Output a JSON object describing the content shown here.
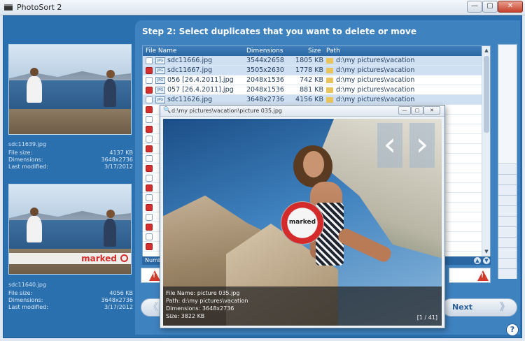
{
  "window": {
    "title": "PhotoSort 2",
    "min": "—",
    "max": "▢",
    "close": "✕"
  },
  "left_panel": {
    "photo1": {
      "filename": "sdc11639.jpg",
      "labels": {
        "size": "File size:",
        "dims": "Dimensions:",
        "modified": "Last modified:"
      },
      "size": "4137 KB",
      "dimensions": "3648x2736",
      "modified": "3/17/2012"
    },
    "photo2": {
      "marked_label": "marked",
      "filename": "sdc11640.jpg",
      "labels": {
        "size": "File size:",
        "dims": "Dimensions:",
        "modified": "Last modified:"
      },
      "size": "4056 KB",
      "dimensions": "3648x2736",
      "modified": "3/17/2012"
    }
  },
  "step": {
    "title": "Step 2:  Select duplicates that you want to delete or move"
  },
  "filelist": {
    "headers": {
      "name": "File Name",
      "dims": "Dimensions",
      "size": "Size",
      "path": "Path"
    },
    "rows": [
      {
        "name": "sdc11666.jpg",
        "dims": "3544x2658",
        "size": "1805 KB",
        "path": "d:\\my pictures\\vacation",
        "checked": false
      },
      {
        "name": "sdc11667.jpg",
        "dims": "3505x2630",
        "size": "1778 KB",
        "path": "d:\\my pictures\\vacation",
        "checked": true
      },
      {
        "name": "056 [26.4.2011].jpg",
        "dims": "2048x1536",
        "size": "742 KB",
        "path": "d:\\my pictures\\vacation",
        "checked": false
      },
      {
        "name": "057 [26.4.2011].jpg",
        "dims": "2048x1536",
        "size": "881 KB",
        "path": "d:\\my pictures\\vacation",
        "checked": true
      },
      {
        "name": "sdc11626.jpg",
        "dims": "3648x2736",
        "size": "4156 KB",
        "path": "d:\\my pictures\\vacation",
        "checked": false
      }
    ],
    "footer_label": "Numb",
    "scroll_up": "▲",
    "scroll_down": "▼",
    "nav_up": "▲",
    "nav_down": "▼"
  },
  "warnings": {
    "symbol": "!"
  },
  "buttons": {
    "back_arrow": "《",
    "next": "Next",
    "next_arrow": "》",
    "help": "?"
  },
  "preview": {
    "title": "d:\\my pictures\\vacation\\picture 035.jpg",
    "search_icon": "🔍",
    "min": "—",
    "max": "▢",
    "close": "✕",
    "marked_label": "marked",
    "prev_arrow": "‹",
    "next_arrow": "›",
    "info": {
      "filename_line": "File Name: picture 035.jpg",
      "path_line": "Path: d:\\my pictures\\vacation",
      "dims_line": "Dimensions: 3648x2736",
      "size_line": "Size: 3822 KB"
    },
    "counter": "[1 / 41]"
  },
  "colors": {
    "accent": "#2a6fae",
    "panel": "#3f82c0",
    "marked": "#d32f2f"
  }
}
